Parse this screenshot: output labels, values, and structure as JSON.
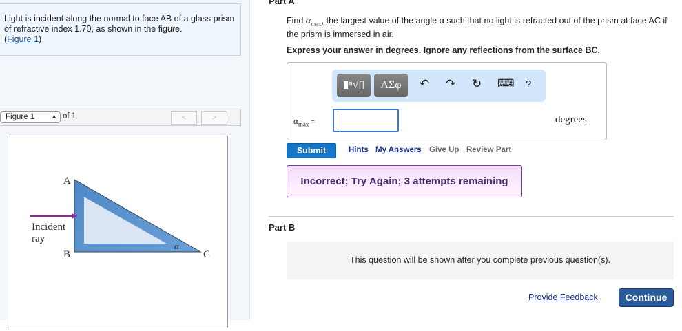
{
  "problem": {
    "text": "Light is incident along the normal to face AB of a glass prism of refractive index 1.70, as shown in the figure.",
    "figure_link": "Figure 1"
  },
  "figure_nav": {
    "selected": "Figure 1",
    "of": "of 1",
    "prev": "<",
    "next": ">"
  },
  "figure": {
    "labels": {
      "A": "A",
      "B": "B",
      "C": "C",
      "alpha": "α",
      "incident": "Incident",
      "ray": "ray"
    },
    "colors": {
      "prism": "#5b95cf",
      "ray": "#8a2a8e"
    }
  },
  "partA": {
    "title": "Part A",
    "question_pre": "Find ",
    "var": "α",
    "var_sub": "max",
    "question_post": ", the largest value of the angle α such that no light is refracted out of the prism at face AC if the prism is immersed in air.",
    "instruction": "Express your answer in degrees. Ignore any reflections from the surface BC.",
    "toolbar": {
      "template": "▮ⁿ√▯",
      "greek": "ΑΣφ",
      "undo": "↶",
      "redo": "↷",
      "reset": "↻",
      "keyboard": "⌨",
      "help": "?"
    },
    "answer_label": "α",
    "answer_sub": "max",
    "answer_eq": " =",
    "answer_value": "",
    "units": "degrees",
    "submit": "Submit",
    "hints": "Hints",
    "my_answers": "My Answers",
    "give_up": "Give Up",
    "review": "Review Part",
    "feedback": "Incorrect; Try Again; 3 attempts remaining"
  },
  "partB": {
    "title": "Part B",
    "locked_text": "This question will be shown after you complete previous question(s)."
  },
  "footer": {
    "provide_feedback": "Provide Feedback",
    "continue": "Continue"
  }
}
